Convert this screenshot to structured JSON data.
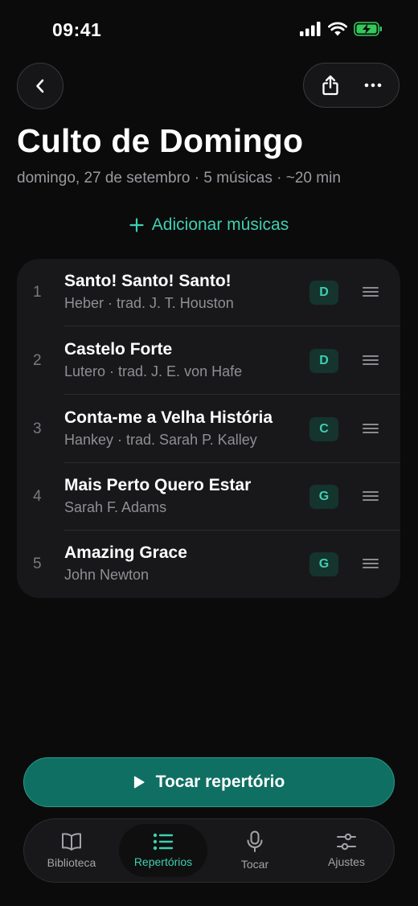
{
  "status": {
    "time": "09:41"
  },
  "header": {
    "title": "Culto de Domingo",
    "subtitle": "domingo, 27 de setembro · 5 músicas · ~20 min"
  },
  "add_songs_label": "Adicionar músicas",
  "songs": [
    {
      "number": "1",
      "title": "Santo! Santo! Santo!",
      "author": "Heber · trad. J. T. Houston",
      "key": "D"
    },
    {
      "number": "2",
      "title": "Castelo Forte",
      "author": "Lutero · trad. J. E. von Hafe",
      "key": "D"
    },
    {
      "number": "3",
      "title": "Conta-me a Velha História",
      "author": "Hankey · trad. Sarah P. Kalley",
      "key": "C"
    },
    {
      "number": "4",
      "title": "Mais Perto Quero Estar",
      "author": "Sarah F. Adams",
      "key": "G"
    },
    {
      "number": "5",
      "title": "Amazing Grace",
      "author": "John Newton",
      "key": "G"
    }
  ],
  "play_button_label": "Tocar repertório",
  "tabs": [
    {
      "label": "Biblioteca",
      "icon": "book-icon",
      "active": false
    },
    {
      "label": "Repertórios",
      "icon": "list-icon",
      "active": true
    },
    {
      "label": "Tocar",
      "icon": "microphone-icon",
      "active": false
    },
    {
      "label": "Ajustes",
      "icon": "sliders-icon",
      "active": false
    }
  ],
  "colors": {
    "accent": "#3fcfb0",
    "play_button": "#0f6f62",
    "background": "#0b0b0c",
    "card": "#18181a",
    "battery_green": "#34c759"
  }
}
